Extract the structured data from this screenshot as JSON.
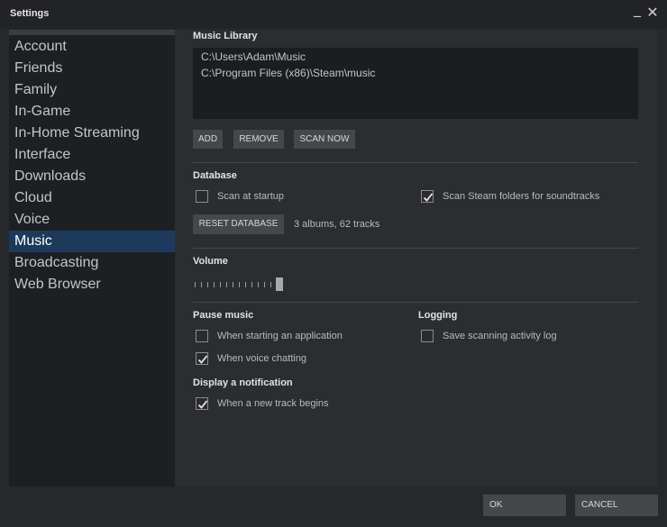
{
  "window": {
    "title": "Settings",
    "minimize_glyph": "_",
    "close_glyph": "✕"
  },
  "sidebar": {
    "items": [
      {
        "label": "Account"
      },
      {
        "label": "Friends"
      },
      {
        "label": "Family"
      },
      {
        "label": "In-Game"
      },
      {
        "label": "In-Home Streaming"
      },
      {
        "label": "Interface"
      },
      {
        "label": "Downloads"
      },
      {
        "label": "Cloud"
      },
      {
        "label": "Voice"
      },
      {
        "label": "Music",
        "active": true
      },
      {
        "label": "Broadcasting"
      },
      {
        "label": "Web Browser"
      }
    ]
  },
  "music_library": {
    "title": "Music Library",
    "paths": [
      "C:\\Users\\Adam\\Music",
      "C:\\Program Files (x86)\\Steam\\music"
    ],
    "add_label": "ADD",
    "remove_label": "REMOVE",
    "scan_now_label": "SCAN NOW"
  },
  "database": {
    "title": "Database",
    "scan_at_startup": {
      "label": "Scan at startup",
      "checked": false
    },
    "scan_steam_folders": {
      "label": "Scan Steam folders for soundtracks",
      "checked": true
    },
    "reset_label": "RESET DATABASE",
    "summary": "3 albums, 62 tracks"
  },
  "volume": {
    "title": "Volume",
    "level": 1.0
  },
  "pause_music": {
    "title": "Pause music",
    "starting_app": {
      "label": "When starting an application",
      "checked": false
    },
    "voice_chatting": {
      "label": "When voice chatting",
      "checked": true
    }
  },
  "logging": {
    "title": "Logging",
    "scan_log": {
      "label": "Save scanning activity log",
      "checked": false
    }
  },
  "notification": {
    "title": "Display a notification",
    "new_track": {
      "label": "When a new track begins",
      "checked": true
    }
  },
  "footer": {
    "ok_label": "OK",
    "cancel_label": "CANCEL"
  },
  "colors": {
    "accent_selected": "#1d3a5c",
    "background": "#2c2d31",
    "sidebar": "#1e1f22"
  }
}
